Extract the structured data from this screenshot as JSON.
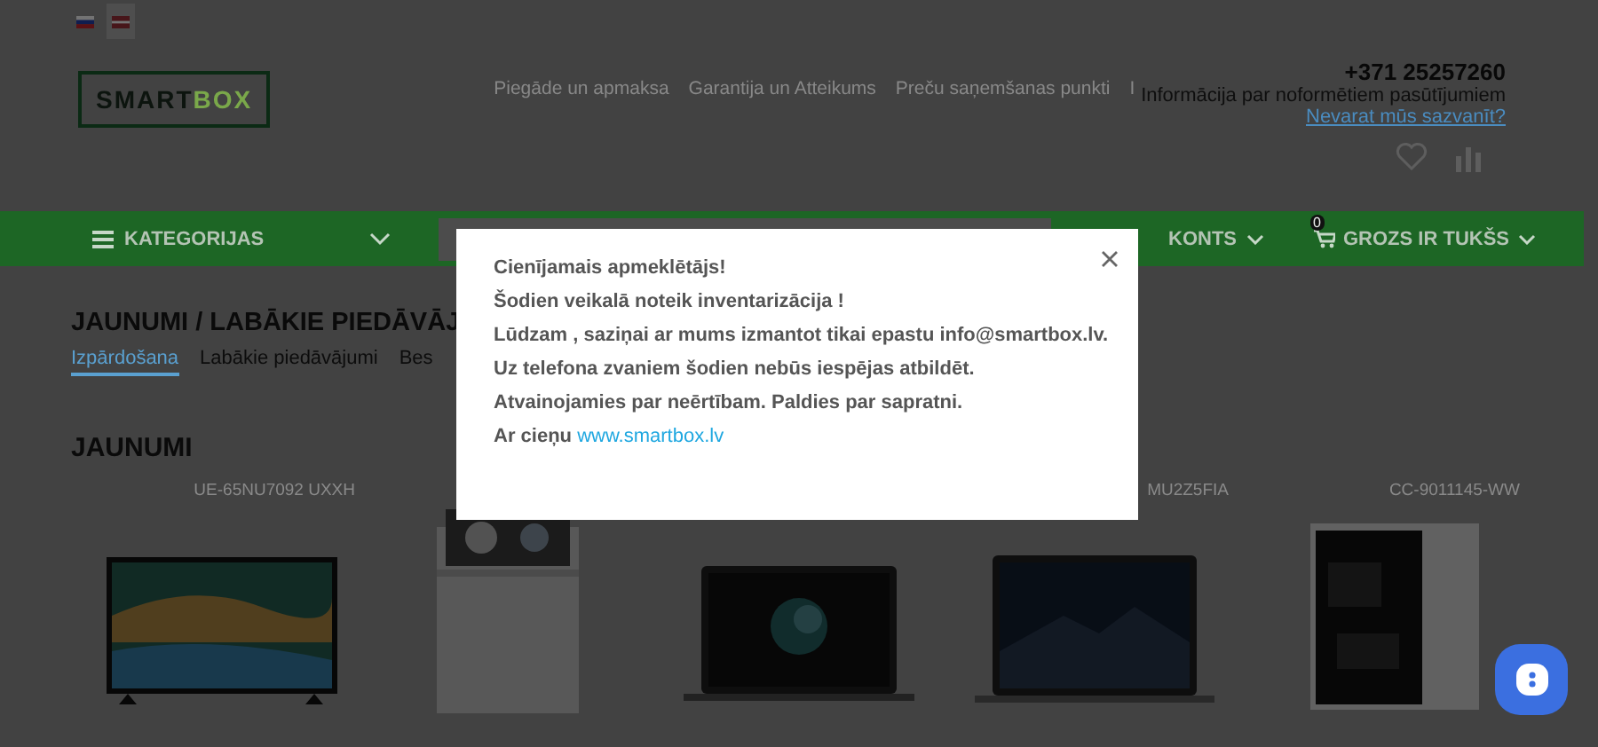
{
  "languages": [
    {
      "kind": "ru",
      "selected": false
    },
    {
      "kind": "lv",
      "selected": true
    }
  ],
  "logo": {
    "first": "SMART",
    "second": "BOX"
  },
  "nav_links": [
    "Piegāde un apmaksa",
    "Garantija un Atteikums",
    "Preču saņemšanas punkti",
    "I"
  ],
  "contact": {
    "phone": "+371 25257260",
    "info": "Informācija par noformētiem pasūtījumiem",
    "link": "Nevarat mūs sazvanīt?"
  },
  "menu_bar": {
    "categories": "KATEGORIJAS",
    "account": "KONTS",
    "cart_count": "0",
    "cart": "GROZS IR TUKŠS"
  },
  "heading": "JAUNUMI / LABĀKIE PIEDĀVĀJ",
  "tabs": [
    {
      "label": "Izpārdošana",
      "selected": true
    },
    {
      "label": "Labākie piedāvājumi",
      "selected": false
    },
    {
      "label": "Bes",
      "selected": false
    }
  ],
  "section_title": "JAUNUMI",
  "products": [
    {
      "kind": "tv",
      "title": "UE-65NU7092 UXXH"
    },
    {
      "kind": "dishwasher"
    },
    {
      "kind": "laptop"
    },
    {
      "kind": "laptop2",
      "title": "MU2Z5FIA"
    },
    {
      "kind": "pc",
      "title": "CC-9011145-WW"
    }
  ],
  "modal": {
    "lines": [
      "Cienījamais apmeklētājs!",
      "Šodien veikalā noteik inventarizācija !",
      "Lūdzam , saziņai ar mums izmantot tikai epastu info@smartbox.lv.",
      "Uz telefona zvaniem šodien nebūs iespējas atbildēt.",
      "Atvainojamies par neērtībam. Paldies par sapratni."
    ],
    "closing": "Ar cieņu",
    "closing_link": "www.smartbox.lv"
  }
}
